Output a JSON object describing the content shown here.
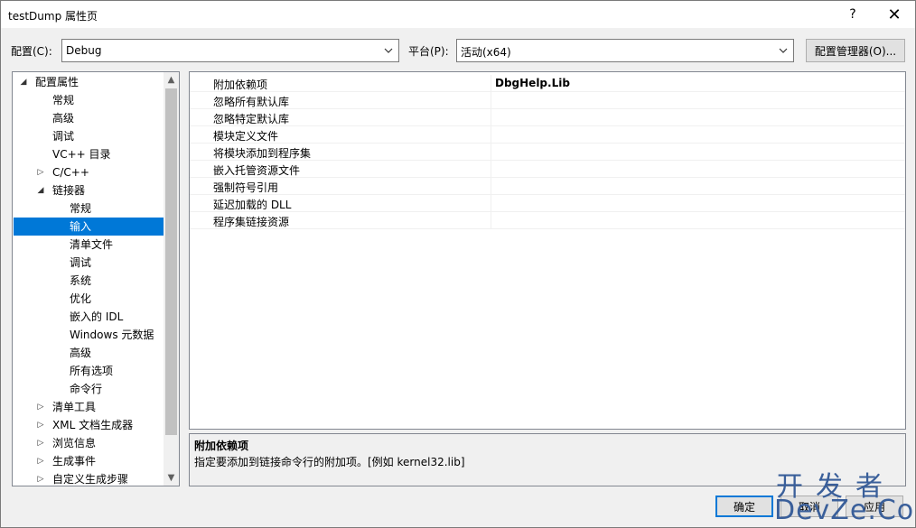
{
  "window": {
    "title": "testDump 属性页",
    "help_label": "?",
    "close_label": "✕"
  },
  "config": {
    "config_label": "配置(C):",
    "config_value": "Debug",
    "platform_label": "平台(P):",
    "platform_value": "活动(x64)",
    "manager_button": "配置管理器(O)..."
  },
  "tree": {
    "items": [
      {
        "label": "配置属性",
        "expander": "◢"
      },
      {
        "label": "常规",
        "expander": ""
      },
      {
        "label": "高级",
        "expander": ""
      },
      {
        "label": "调试",
        "expander": ""
      },
      {
        "label": "VC++ 目录",
        "expander": ""
      },
      {
        "label": "C/C++",
        "expander": "▷"
      },
      {
        "label": "链接器",
        "expander": "◢"
      },
      {
        "label": "常规",
        "expander": ""
      },
      {
        "label": "输入",
        "expander": ""
      },
      {
        "label": "清单文件",
        "expander": ""
      },
      {
        "label": "调试",
        "expander": ""
      },
      {
        "label": "系统",
        "expander": ""
      },
      {
        "label": "优化",
        "expander": ""
      },
      {
        "label": "嵌入的 IDL",
        "expander": ""
      },
      {
        "label": "Windows 元数据",
        "expander": ""
      },
      {
        "label": "高级",
        "expander": ""
      },
      {
        "label": "所有选项",
        "expander": ""
      },
      {
        "label": "命令行",
        "expander": ""
      },
      {
        "label": "清单工具",
        "expander": "▷"
      },
      {
        "label": "XML 文档生成器",
        "expander": "▷"
      },
      {
        "label": "浏览信息",
        "expander": "▷"
      },
      {
        "label": "生成事件",
        "expander": "▷"
      },
      {
        "label": "自定义生成步骤",
        "expander": "▷"
      }
    ],
    "selected_index": 8,
    "scroll_up": "▲",
    "scroll_down": "▼"
  },
  "grid": {
    "rows": [
      {
        "name": "附加依赖项",
        "value": "DbgHelp.Lib"
      },
      {
        "name": "忽略所有默认库",
        "value": ""
      },
      {
        "name": "忽略特定默认库",
        "value": ""
      },
      {
        "name": "模块定义文件",
        "value": ""
      },
      {
        "name": "将模块添加到程序集",
        "value": ""
      },
      {
        "name": "嵌入托管资源文件",
        "value": ""
      },
      {
        "name": "强制符号引用",
        "value": ""
      },
      {
        "name": "延迟加载的 DLL",
        "value": ""
      },
      {
        "name": "程序集链接资源",
        "value": ""
      }
    ]
  },
  "description": {
    "title": "附加依赖项",
    "text": "指定要添加到链接命令行的附加项。[例如 kernel32.lib]"
  },
  "buttons": {
    "ok": "确定",
    "cancel": "取消",
    "apply": "应用"
  },
  "watermark": {
    "line1": "开发者",
    "line2": "DevZe.CoM"
  }
}
